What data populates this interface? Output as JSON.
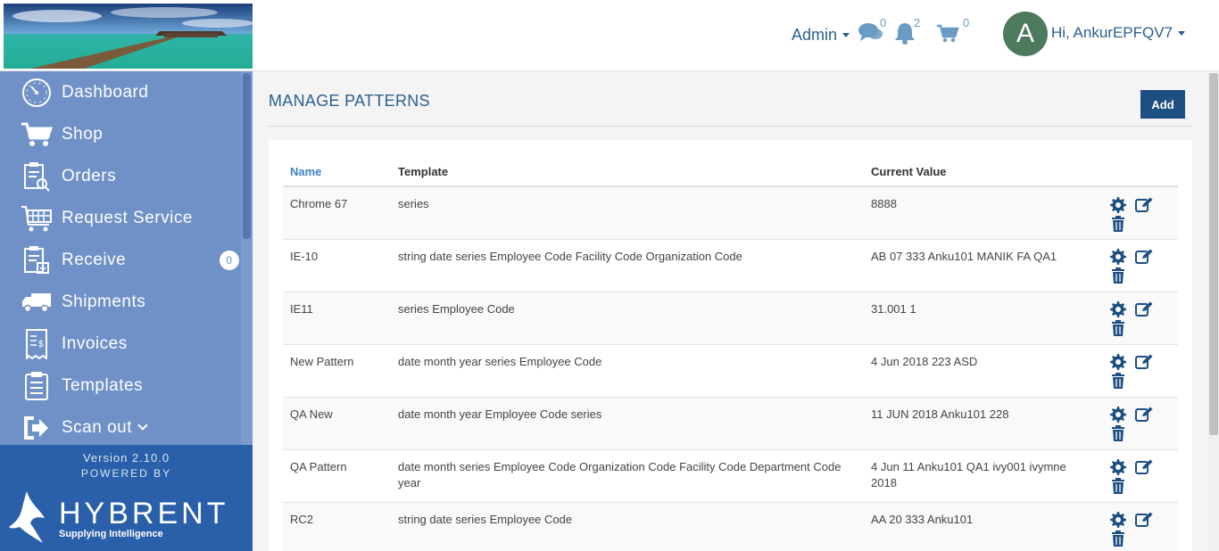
{
  "header": {
    "admin_label": "Admin",
    "messages_count": "0",
    "notifications_count": "2",
    "cart_count": "0",
    "avatar_letter": "A",
    "greeting": "Hi, AnkurEPFQV7"
  },
  "sidebar": {
    "items": [
      {
        "label": "Dashboard",
        "icon": "dashboard-gauge-icon"
      },
      {
        "label": "Shop",
        "icon": "shopping-cart-icon"
      },
      {
        "label": "Orders",
        "icon": "orders-clipboard-icon"
      },
      {
        "label": "Request Service",
        "icon": "request-service-cart-icon"
      },
      {
        "label": "Receive",
        "icon": "receive-clipboard-icon",
        "badge": "0"
      },
      {
        "label": "Shipments",
        "icon": "truck-icon"
      },
      {
        "label": "Invoices",
        "icon": "invoice-receipt-icon"
      },
      {
        "label": "Templates",
        "icon": "templates-clipboard-icon"
      },
      {
        "label": "Scan out",
        "icon": "sign-out-icon"
      }
    ],
    "version": "Version 2.10.0",
    "powered_by": "POWERED BY",
    "brand": "HYBRENT",
    "tagline": "Supplying Intelligence"
  },
  "main": {
    "title": "MANAGE PATTERNS",
    "add_label": "Add",
    "columns": {
      "name": "Name",
      "template": "Template",
      "current": "Current Value"
    },
    "rows": [
      {
        "name": "Chrome 67",
        "template": "series",
        "current": "8888"
      },
      {
        "name": "IE-10",
        "template": "string date series Employee Code Facility Code Organization Code",
        "current": "AB 07 333 Anku101 MANIK FA QA1"
      },
      {
        "name": "IE11",
        "template": "series Employee Code",
        "current": "31.001 1"
      },
      {
        "name": "New Pattern",
        "template": "date month year series Employee Code",
        "current": "4 Jun 2018 223 ASD"
      },
      {
        "name": "QA New",
        "template": "date month year Employee Code series",
        "current": "11 JUN 2018 Anku101 228"
      },
      {
        "name": "QA Pattern",
        "template": "date month series Employee Code Organization Code Facility Code Department Code year",
        "current": "4 Jun 11 Anku101 QA1 ivy001 ivymne 2018"
      },
      {
        "name": "RC2",
        "template": "string date series Employee Code",
        "current": "AA 20 333 Anku101"
      }
    ]
  },
  "colors": {
    "sidebar": "#6f91c8",
    "sidebar_footer": "#2a5fa9",
    "accent": "#1d4f82",
    "link": "#3b84c4"
  }
}
